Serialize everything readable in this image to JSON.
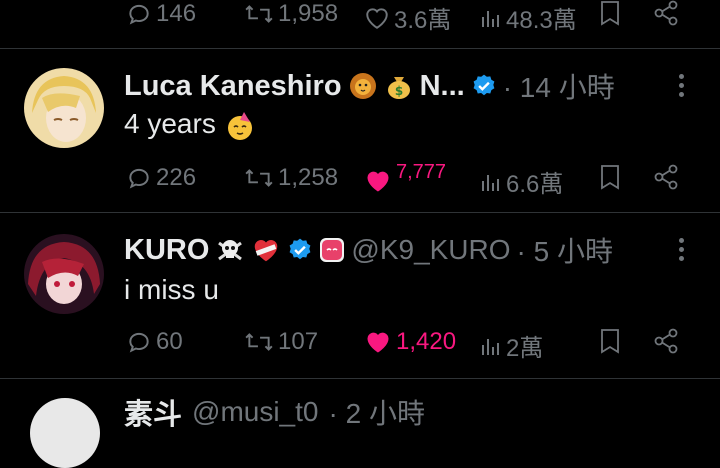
{
  "top_actions": {
    "replies": "146",
    "reposts": "1,958",
    "likes": "3.6萬",
    "views": "48.3萬"
  },
  "tweets": [
    {
      "display_name": "Luca Kaneshiro",
      "name_suffix": "N...",
      "time": "· 14 小時",
      "text": "4 years",
      "replies": "226",
      "reposts": "1,258",
      "likes": "7,777",
      "views": "6.6萬",
      "liked": true
    },
    {
      "display_name": "KURO",
      "handle": "@K9_KURO",
      "time": "· 5 小時",
      "text": "i miss u",
      "replies": "60",
      "reposts": "107",
      "likes": "1,420",
      "views": "2萬",
      "liked": true
    },
    {
      "display_name": "素斗",
      "handle": "@musi_t0",
      "time": "· 2 小時"
    }
  ],
  "colors": {
    "like": "#f91880",
    "verified": "#1d9bf0",
    "muted": "#71767b",
    "divider": "#2f3336"
  }
}
